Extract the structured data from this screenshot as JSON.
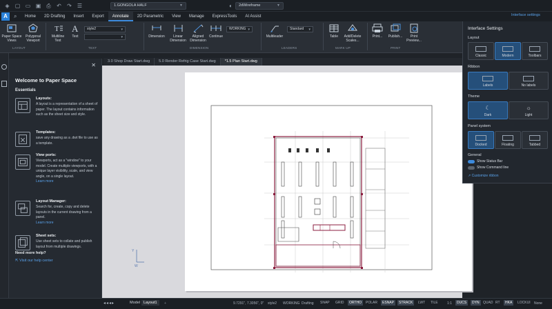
{
  "titlebar": {
    "project_combo": "1.GONGOLA HALF",
    "visual_style_combo": "2dWireframe"
  },
  "ribbon_tabs": [
    "Home",
    "2D Drafting",
    "Insert",
    "Export",
    "Annotate",
    "2D Parametric",
    "View",
    "Manage",
    "ExpressTools",
    "AI Assist"
  ],
  "active_tab": "Annotate",
  "ribbon": {
    "paper_space_views": "Paper Space Views",
    "polygonal_viewport": "Polygonal Viewport",
    "multiline_text": "Multiline Text",
    "text": "Text",
    "text_style": "style2",
    "dimension": "Dimension",
    "linear_dimension": "Linear Dimension",
    "aligned_dimension": "Aligned Dimension",
    "continue": "Continue",
    "dim_style": "WORKING",
    "multileader": "Multileader",
    "leader_style": "Standard",
    "table": "Table",
    "add_delete_scales": "Add/Delete Scales...",
    "print": "Print...",
    "publish": "Publish...",
    "print_preview": "Print Preview...",
    "groups": {
      "layout": "LAYOUT",
      "text": "TEXT",
      "dimension": "DIMENSION",
      "leaders": "LEADERS",
      "markup": "MARK UP",
      "print": "PRINT"
    }
  },
  "doc_tabs": [
    "3.0 Shop Draw Start.dwg",
    "5.0 Render Refrig Case Start.dwg",
    "*1.5 Plan Start.dwg"
  ],
  "active_doc_tab": "*1.5 Plan Start.dwg",
  "welcome": {
    "title": "Welcome to Paper Space",
    "section": "Essentials",
    "items": [
      {
        "title": "Layouts:",
        "body": "A layout is a representation of a sheet of paper. The layout contains information such as the sheet size and style.",
        "link": ""
      },
      {
        "title": "Templates:",
        "body": "save any drawing as a .dwt file to use as a template.",
        "link": ""
      },
      {
        "title": "View ports:",
        "body": "Viewports, act as a \"window\" to your model. Create multiple viewports, with a unique layer visibility, scale, and view angle, on a single layout.",
        "link": "Learn more"
      },
      {
        "title": "Layout Manager:",
        "body": "Search for, create, copy and delete layouts in the current drawing from a panel.",
        "link": "Learn more"
      },
      {
        "title": "Sheet sets:",
        "body": "Use sheet sets to collate and publish layout from multiple drawings.",
        "link": ""
      }
    ],
    "help_title": "Need more help?",
    "help_link": "Visit our help center"
  },
  "interface_settings": {
    "link": "Interface settings",
    "title": "Interface Settings",
    "layout_label": "Layout",
    "layout_options": [
      "Classic",
      "Modern",
      "Toolbars"
    ],
    "layout_selected": "Modern",
    "ribbon_label": "Ribbon",
    "ribbon_options": [
      "Labels",
      "No labels"
    ],
    "ribbon_selected": "Labels",
    "theme_label": "Theme",
    "theme_options": [
      "Dark",
      "Light"
    ],
    "theme_selected": "Dark",
    "panel_label": "Panel system",
    "panel_options": [
      "Docked",
      "Floating",
      "Tabbed"
    ],
    "panel_selected": "Docked",
    "general_label": "General",
    "show_status_bar": "Show Status Bar",
    "show_command_line": "Show Command line",
    "customize_ribbon": "Customize ribbon"
  },
  "statusbar": {
    "model": "Model",
    "layout": "Layout1",
    "coords": "9.7291\", 7.3056\", 0\"",
    "style": "style2",
    "dimstyle": "WORKING",
    "workspace": "Drafting",
    "toggles": [
      {
        "label": "SNAP",
        "on": false
      },
      {
        "label": "GRID",
        "on": false
      },
      {
        "label": "ORTHO",
        "on": true
      },
      {
        "label": "POLAR",
        "on": false
      },
      {
        "label": "ESNAP",
        "on": true
      },
      {
        "label": "STRACK",
        "on": true
      },
      {
        "label": "LWT",
        "on": false
      },
      {
        "label": "TILE",
        "on": false
      }
    ],
    "scale": "1:1",
    "ducs": "DUCS",
    "dyn": "DYN",
    "quad": "QUAD",
    "rt": "RT",
    "hka": "HKA",
    "lockui": "LOCKUI",
    "none": "None"
  }
}
